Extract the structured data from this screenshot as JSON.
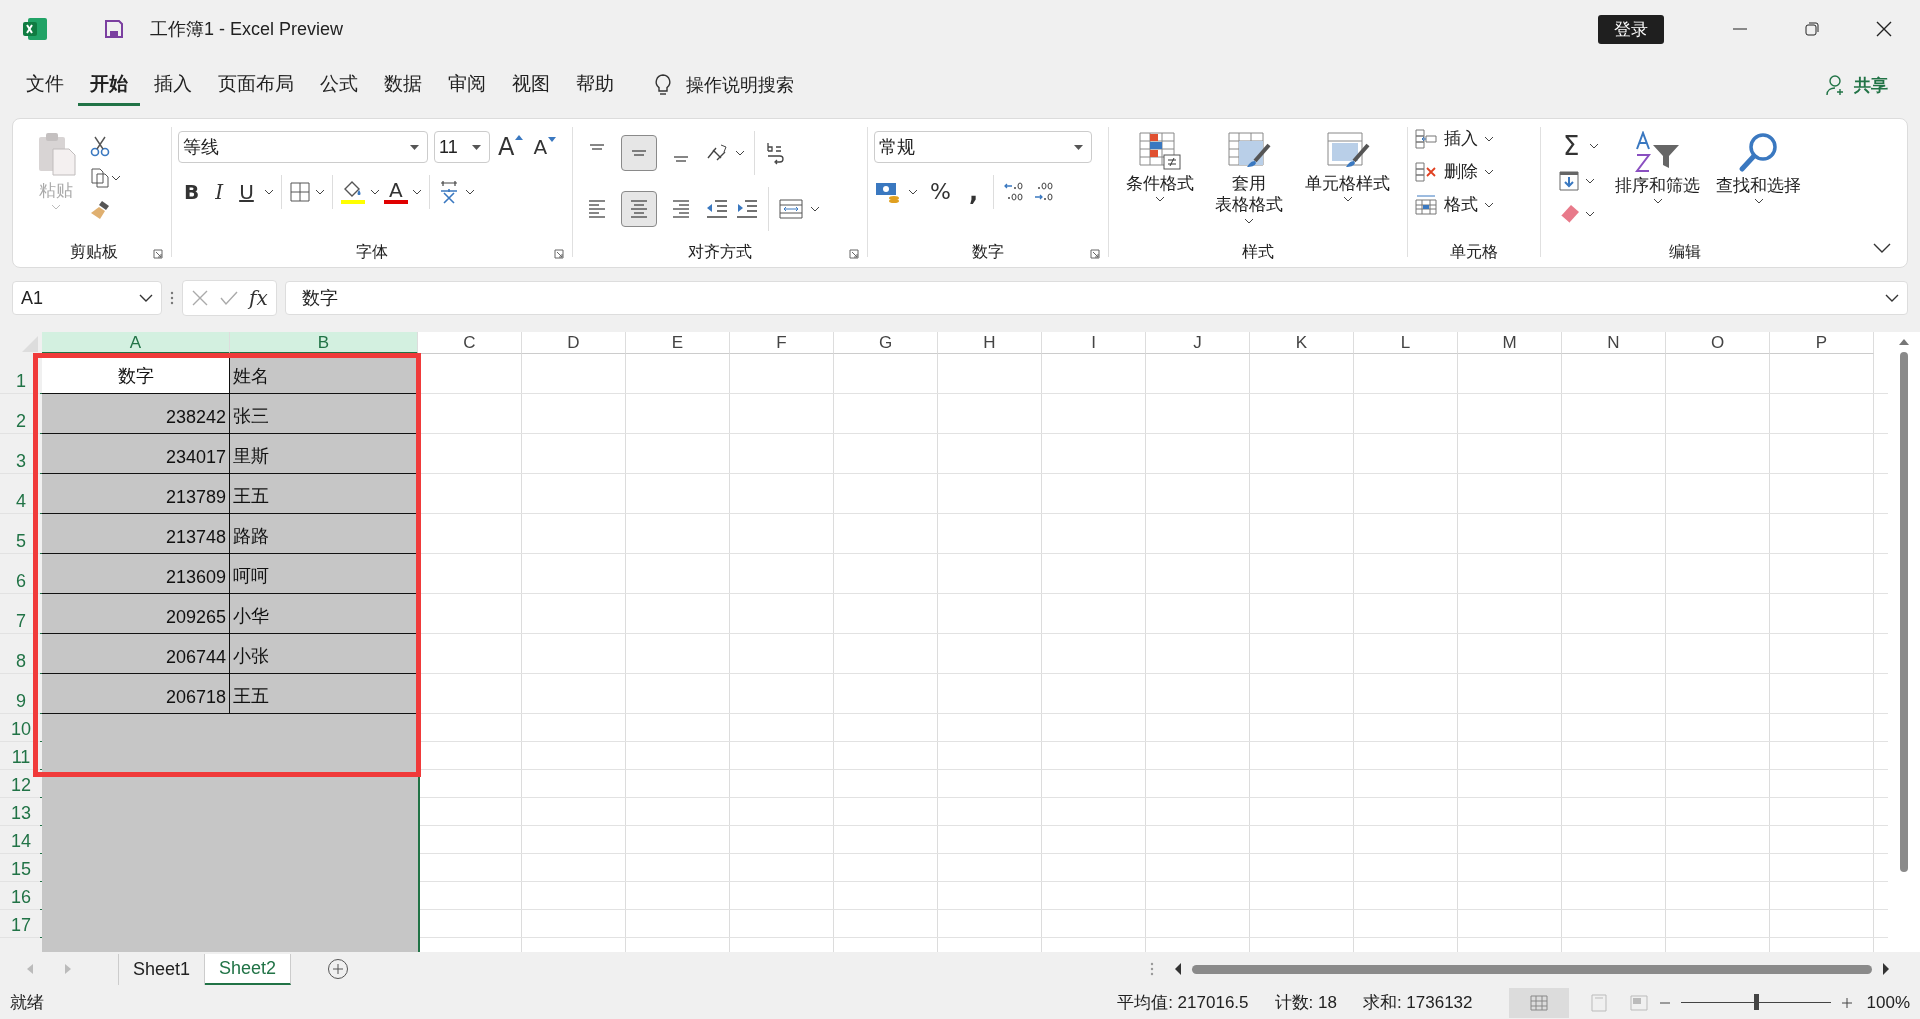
{
  "window": {
    "title": "工作簿1  -  Excel Preview",
    "sign_in": "登录"
  },
  "menu": {
    "tabs": [
      {
        "label": "文件",
        "selected": false
      },
      {
        "label": "开始",
        "selected": true
      },
      {
        "label": "插入",
        "selected": false
      },
      {
        "label": "页面布局",
        "selected": false
      },
      {
        "label": "公式",
        "selected": false
      },
      {
        "label": "数据",
        "selected": false
      },
      {
        "label": "审阅",
        "selected": false
      },
      {
        "label": "视图",
        "selected": false
      },
      {
        "label": "帮助",
        "selected": false
      }
    ],
    "search": "操作说明搜索",
    "share": "共享"
  },
  "ribbon": {
    "clipboard": {
      "paste": {
        "label": "粘贴",
        "disabled": true
      },
      "group": "剪贴板"
    },
    "font": {
      "name": "等线",
      "size": "11",
      "grow": "A",
      "shrink": "A",
      "bold": "B",
      "italic": "I",
      "underline": "U",
      "font_color": "A",
      "group": "字体"
    },
    "alignment": {
      "vertical": [
        {
          "kind": "top",
          "selected": false
        },
        {
          "kind": "middle",
          "selected": true
        },
        {
          "kind": "bottom",
          "selected": false
        }
      ],
      "horizontal": [
        {
          "kind": "left",
          "selected": false
        },
        {
          "kind": "center",
          "selected": true
        },
        {
          "kind": "right",
          "selected": false
        }
      ],
      "group": "对齐方式"
    },
    "number": {
      "format": "常规",
      "percent": "%",
      "comma": ",",
      "group": "数字"
    },
    "styles": {
      "buttons": [
        {
          "lines": [
            "条件格式"
          ]
        },
        {
          "lines": [
            "套用",
            "表格格式"
          ]
        },
        {
          "lines": [
            "单元格样式"
          ]
        }
      ],
      "group": "样式"
    },
    "cells": {
      "buttons": [
        "插入",
        "删除",
        "格式"
      ],
      "group": "单元格"
    },
    "editing": {
      "sum": "Σ",
      "sort": "排序和筛选",
      "find": "查找和选择",
      "group": "编辑"
    }
  },
  "formula_bar": {
    "name_box": "A1",
    "function_label": "fx",
    "content": "数字"
  },
  "sheet": {
    "columns": [
      {
        "label": "A",
        "selected": true
      },
      {
        "label": "B",
        "selected": true
      },
      {
        "label": "C",
        "selected": false
      },
      {
        "label": "D",
        "selected": false
      },
      {
        "label": "E",
        "selected": false
      },
      {
        "label": "F",
        "selected": false
      },
      {
        "label": "G",
        "selected": false
      },
      {
        "label": "H",
        "selected": false
      },
      {
        "label": "I",
        "selected": false
      },
      {
        "label": "J",
        "selected": false
      },
      {
        "label": "K",
        "selected": false
      },
      {
        "label": "L",
        "selected": false
      },
      {
        "label": "M",
        "selected": false
      },
      {
        "label": "N",
        "selected": false
      },
      {
        "label": "O",
        "selected": false
      },
      {
        "label": "P",
        "selected": false
      }
    ],
    "rows": [
      {
        "label": "1",
        "selected": true,
        "cells": [
          {
            "text": "数字",
            "kind": "heading",
            "active": true
          },
          {
            "text": "姓名",
            "kind": "text",
            "active": false
          }
        ]
      },
      {
        "label": "2",
        "selected": true,
        "cells": [
          {
            "text": "238242",
            "kind": "number",
            "active": false
          },
          {
            "text": "张三",
            "kind": "text",
            "active": false
          }
        ]
      },
      {
        "label": "3",
        "selected": true,
        "cells": [
          {
            "text": "234017",
            "kind": "number",
            "active": false
          },
          {
            "text": "里斯",
            "kind": "text",
            "active": false
          }
        ]
      },
      {
        "label": "4",
        "selected": true,
        "cells": [
          {
            "text": "213789",
            "kind": "number",
            "active": false
          },
          {
            "text": "王五",
            "kind": "text",
            "active": false
          }
        ]
      },
      {
        "label": "5",
        "selected": true,
        "cells": [
          {
            "text": "213748",
            "kind": "number",
            "active": false
          },
          {
            "text": "路路",
            "kind": "text",
            "active": false
          }
        ]
      },
      {
        "label": "6",
        "selected": true,
        "cells": [
          {
            "text": "213609",
            "kind": "number",
            "active": false
          },
          {
            "text": "呵呵",
            "kind": "text",
            "active": false
          }
        ]
      },
      {
        "label": "7",
        "selected": true,
        "cells": [
          {
            "text": "209265",
            "kind": "number",
            "active": false
          },
          {
            "text": "小华",
            "kind": "text",
            "active": false
          }
        ]
      },
      {
        "label": "8",
        "selected": true,
        "cells": [
          {
            "text": "206744",
            "kind": "number",
            "active": false
          },
          {
            "text": "小张",
            "kind": "text",
            "active": false
          }
        ]
      },
      {
        "label": "9",
        "selected": true,
        "cells": [
          {
            "text": "206718",
            "kind": "number",
            "active": false
          },
          {
            "text": "王五",
            "kind": "text",
            "active": false
          }
        ]
      },
      {
        "label": "10",
        "selected": true
      },
      {
        "label": "11",
        "selected": true
      },
      {
        "label": "12",
        "selected": true
      },
      {
        "label": "13",
        "selected": true
      },
      {
        "label": "14",
        "selected": true
      },
      {
        "label": "15",
        "selected": true
      },
      {
        "label": "16",
        "selected": true
      },
      {
        "label": "17",
        "selected": true
      }
    ]
  },
  "sheet_tabs": [
    {
      "label": "Sheet1",
      "selected": false
    },
    {
      "label": "Sheet2",
      "selected": true
    }
  ],
  "status_bar": {
    "ready": "就绪",
    "average": "平均值: 217016.5",
    "count": "计数: 18",
    "sum": "求和: 1736132",
    "zoom": {
      "level": 0.5,
      "reading": "100%"
    }
  }
}
